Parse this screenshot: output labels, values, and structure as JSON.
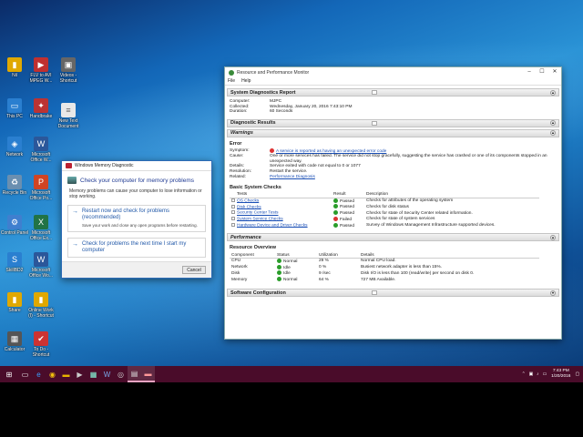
{
  "desktop_icons": [
    {
      "id": "nil",
      "label": "Nil",
      "glyph": "📁",
      "color": "#e0a800"
    },
    {
      "id": "flv",
      "label": "FLV to AVI MPEG W...",
      "glyph": "▶",
      "color": "#c03030"
    },
    {
      "id": "videos",
      "label": "Videos - Shortcut",
      "glyph": "🎬",
      "color": "#557"
    },
    {
      "id": "thispc",
      "label": "This PC",
      "glyph": "🖥",
      "color": "#2a7fd0"
    },
    {
      "id": "handbrake",
      "label": "Handbrake",
      "glyph": "🍍",
      "color": "#b33"
    },
    {
      "id": "newtext",
      "label": "New Text Document",
      "glyph": "📄",
      "color": "#ddd"
    },
    {
      "id": "network",
      "label": "Network",
      "glyph": "🌐",
      "color": "#2a7fd0"
    },
    {
      "id": "word",
      "label": "Microsoft Office W...",
      "glyph": "W",
      "color": "#2b579a"
    },
    {
      "id": "recycle",
      "label": "Recycle Bin",
      "glyph": "🗑",
      "color": "#6a8fb0"
    },
    {
      "id": "ppt",
      "label": "Microsoft Office Po...",
      "glyph": "P",
      "color": "#d04423"
    },
    {
      "id": "control",
      "label": "Control Panel",
      "glyph": "⚙",
      "color": "#3f7fcf"
    },
    {
      "id": "excel",
      "label": "Microsoft Office Ex...",
      "glyph": "X",
      "color": "#217346"
    },
    {
      "id": "skill",
      "label": "SkillBD2",
      "glyph": "S",
      "color": "#2a7fd0"
    },
    {
      "id": "word2",
      "label": "Microsoft Office Wo...",
      "glyph": "W",
      "color": "#2b579a"
    },
    {
      "id": "share",
      "label": "Share",
      "glyph": "📁",
      "color": "#e0a800"
    },
    {
      "id": "online",
      "label": "Online Work (I) - Shortcut",
      "glyph": "📁",
      "color": "#e0a800"
    },
    {
      "id": "calc",
      "label": "Calculator",
      "glyph": "▦",
      "color": "#555"
    },
    {
      "id": "todo",
      "label": "To Do - Shortcut",
      "glyph": "✔",
      "color": "#c33"
    }
  ],
  "mdd": {
    "title": "Windows Memory Diagnostic",
    "heading": "Check your computer for memory problems",
    "desc": "Memory problems can cause your computer to lose information or stop working.",
    "opt1_title": "Restart now and check for problems (recommended)",
    "opt1_sub": "Save your work and close any open programs before restarting.",
    "opt2_title": "Check for problems the next time I start my computer",
    "cancel": "Cancel"
  },
  "rpm": {
    "title": "Resource and Performance Monitor",
    "menu": [
      "File",
      "Help"
    ],
    "report_title": "System Diagnostics Report",
    "computer_label": "Computer:",
    "computer": "MJPC",
    "collected_label": "Collected:",
    "collected": "Wednesday, January 20, 2016 7:43:10 PM",
    "duration_label": "Duration:",
    "duration": "60 Seconds",
    "diag_results": "Diagnostic Results",
    "warnings": "Warnings",
    "error_h": "Error",
    "symptom_label": "Symptom:",
    "symptom": "A service is reported as having an unexpected error code",
    "cause_label": "Cause:",
    "cause": "One or more services has failed. The service did not stop gracefully, suggesting the service has crashed or one of its components stopped in an unexpected way.",
    "details_label": "Details:",
    "details": "Service exited with code not equal to 0 or 1077",
    "resolution_label": "Resolution:",
    "resolution": "Restart the service.",
    "related_label": "Related:",
    "related": "Performance Diagnosis",
    "basic_h": "Basic System Checks",
    "checks_headers": [
      "Tests",
      "Result",
      "Description"
    ],
    "checks": [
      {
        "test": "OS Checks",
        "result": "Passed",
        "desc": "Checks for attributes of the operating system",
        "color": "#2a9d2a"
      },
      {
        "test": "Disk Checks",
        "result": "Passed",
        "desc": "Checks for disk status",
        "color": "#2a9d2a"
      },
      {
        "test": "Security Center Tests",
        "result": "Passed",
        "desc": "Checks for state of Security Center related information.",
        "color": "#2a9d2a"
      },
      {
        "test": "System Service Checks",
        "result": "Failed",
        "desc": "Checks for state of system services",
        "color": "#d33"
      },
      {
        "test": "Hardware Device and Driver Checks",
        "result": "Passed",
        "desc": "Survey of Windows Management Infrastructure supported devices.",
        "color": "#2a9d2a"
      }
    ],
    "performance": "Performance",
    "resource_h": "Resource Overview",
    "res_headers": [
      "Component",
      "Status",
      "Utilization",
      "Details"
    ],
    "resources": [
      {
        "comp": "CPU",
        "status": "Normal",
        "util": "29 %",
        "details": "Normal CPU load.",
        "color": "#2a9d2a"
      },
      {
        "comp": "Network",
        "status": "Idle",
        "util": "0 %",
        "details": "Busiest network adapter is less than 15%.",
        "color": "#2a9d2a"
      },
      {
        "comp": "Disk",
        "status": "Idle",
        "util": "9 /sec",
        "details": "Disk I/O is less than 100 (read/write) per second on disk 0.",
        "color": "#2a9d2a"
      },
      {
        "comp": "Memory",
        "status": "Normal",
        "util": "64 %",
        "details": "727 MB Available.",
        "color": "#2a9d2a"
      }
    ],
    "software": "Software Configuration"
  },
  "taskbar": {
    "time": "7:43 PM",
    "date": "1/20/2016"
  }
}
